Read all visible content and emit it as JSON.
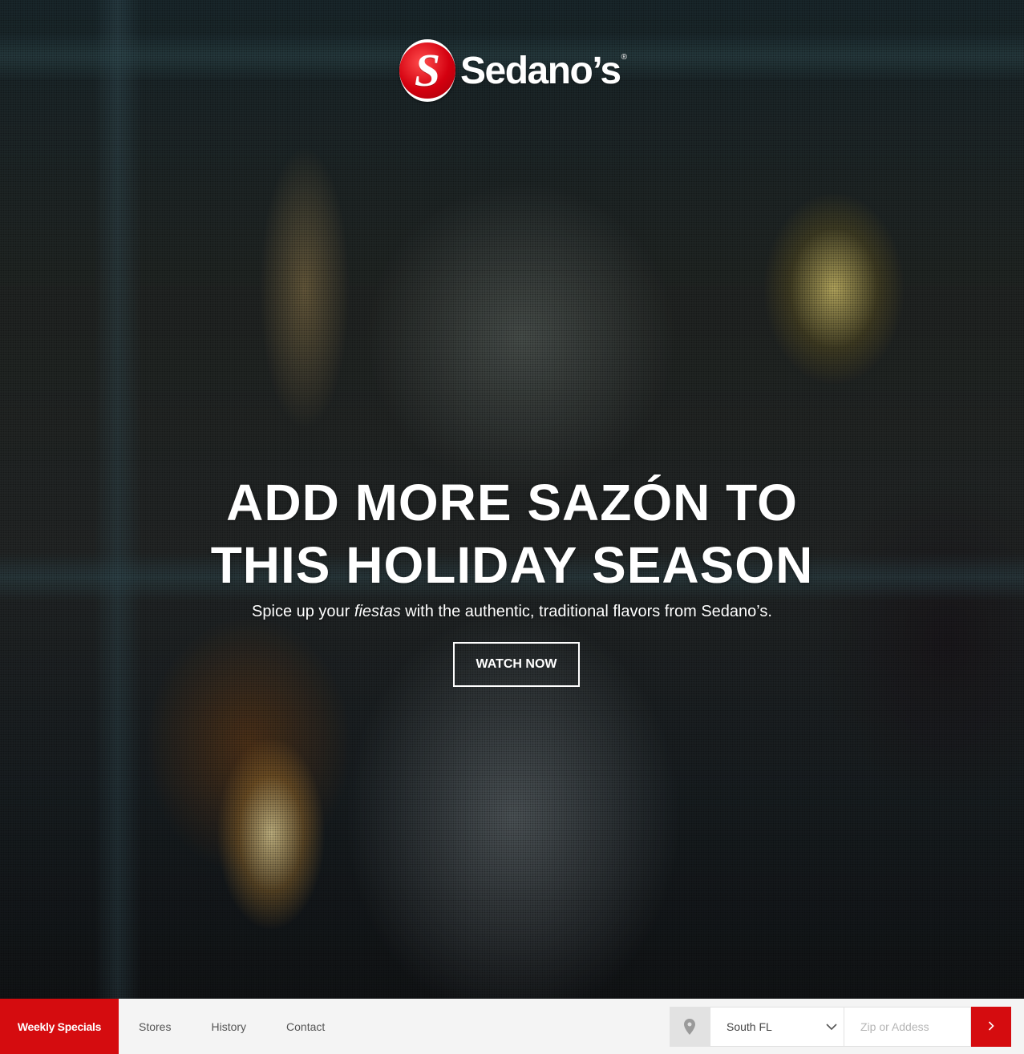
{
  "brand": {
    "name": "Sedano’s",
    "mark_letter": "S",
    "trademark": "®",
    "accent_color": "#d50c0f"
  },
  "hero": {
    "headline_line1": "ADD MORE SAZÓN TO",
    "headline_line2": "THIS HOLIDAY SEASON",
    "sub_before": "Spice up your",
    "sub_emphasis": "fiestas",
    "sub_after": "with the authentic, traditional flavors from Sedano’s.",
    "cta_label": "WATCH NOW"
  },
  "nav": {
    "weekly_specials": "Weekly Specials",
    "links": [
      "Stores",
      "History",
      "Contact"
    ]
  },
  "store_finder": {
    "pin_icon": "map-pin-icon",
    "region_selected": "South FL",
    "dropdown_icon": "chevron-down-icon",
    "zip_placeholder": "Zip or Addess",
    "submit_icon": "chevron-right-icon"
  }
}
